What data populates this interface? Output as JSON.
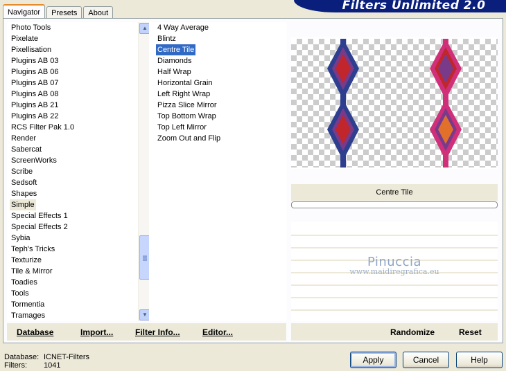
{
  "header": {
    "tabs": [
      {
        "label": "Navigator",
        "active": true
      },
      {
        "label": "Presets",
        "active": false
      },
      {
        "label": "About",
        "active": false
      }
    ],
    "banner_title": "Filters Unlimited 2.0"
  },
  "categories": {
    "selected": "Simple",
    "items": [
      "Photo Tools",
      "Pixelate",
      "Pixellisation",
      "Plugins AB 03",
      "Plugins AB 06",
      "Plugins AB 07",
      "Plugins AB 08",
      "Plugins AB 21",
      "Plugins AB 22",
      "RCS Filter Pak 1.0",
      "Render",
      "Sabercat",
      "ScreenWorks",
      "Scribe",
      "Sedsoft",
      "Shapes",
      "Simple",
      "Special Effects 1",
      "Special Effects 2",
      "Sybia",
      "Teph's Tricks",
      "Texturize",
      "Tile & Mirror",
      "Toadies",
      "Tools",
      "Tormentia",
      "Tramages"
    ]
  },
  "filters": {
    "selected": "Centre Tile",
    "items": [
      "4 Way Average",
      "Blintz",
      "Centre Tile",
      "Diamonds",
      "Half Wrap",
      "Horizontal Grain",
      "Left Right Wrap",
      "Pizza Slice Mirror",
      "Top Bottom Wrap",
      "Top Left Mirror",
      "Zoom Out and Flip"
    ]
  },
  "preview": {
    "filter_name": "Centre Tile",
    "progress": 0,
    "colors": {
      "navy": "#2e3f8f",
      "red": "#c0262c",
      "purple": "#7a3a8a",
      "pink": "#d0307a",
      "orange": "#e0702a"
    }
  },
  "watermark": {
    "name": "Pinuccia",
    "url": "www.maidiregrafica.eu"
  },
  "left_toolbar": {
    "database": "Database",
    "import": "Import...",
    "filter_info": "Filter Info...",
    "editor": "Editor..."
  },
  "right_toolbar": {
    "randomize": "Randomize",
    "reset": "Reset"
  },
  "status": {
    "database_label": "Database:",
    "database_value": "ICNET-Filters",
    "filters_label": "Filters:",
    "filters_value": "1041"
  },
  "dialog": {
    "apply": "Apply",
    "cancel": "Cancel",
    "help": "Help"
  }
}
